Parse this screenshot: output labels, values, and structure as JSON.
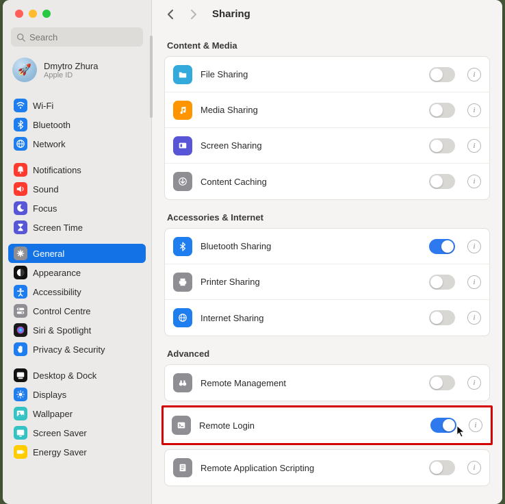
{
  "search": {
    "placeholder": "Search"
  },
  "profile": {
    "name": "Dmytro Zhura",
    "sub": "Apple ID"
  },
  "sidebar": {
    "groups": [
      {
        "items": [
          {
            "label": "Wi-Fi",
            "color": "#1e7def",
            "glyph": "wifi"
          },
          {
            "label": "Bluetooth",
            "color": "#1e7def",
            "glyph": "bt"
          },
          {
            "label": "Network",
            "color": "#1e7def",
            "glyph": "globe"
          }
        ]
      },
      {
        "items": [
          {
            "label": "Notifications",
            "color": "#ff3b30",
            "glyph": "bell"
          },
          {
            "label": "Sound",
            "color": "#ff3b30",
            "glyph": "sound"
          },
          {
            "label": "Focus",
            "color": "#5856d6",
            "glyph": "moon"
          },
          {
            "label": "Screen Time",
            "color": "#5856d6",
            "glyph": "hourglass"
          }
        ]
      },
      {
        "items": [
          {
            "label": "General",
            "color": "#8e8e93",
            "glyph": "gear",
            "selected": true
          },
          {
            "label": "Appearance",
            "color": "#111111",
            "glyph": "appearance"
          },
          {
            "label": "Accessibility",
            "color": "#1e7def",
            "glyph": "access"
          },
          {
            "label": "Control Centre",
            "color": "#8e8e93",
            "glyph": "switches"
          },
          {
            "label": "Siri & Spotlight",
            "color": "#1a1a1a",
            "glyph": "siri"
          },
          {
            "label": "Privacy & Security",
            "color": "#1e7def",
            "glyph": "hand"
          }
        ]
      },
      {
        "items": [
          {
            "label": "Desktop & Dock",
            "color": "#111111",
            "glyph": "dock"
          },
          {
            "label": "Displays",
            "color": "#1e7def",
            "glyph": "sun"
          },
          {
            "label": "Wallpaper",
            "color": "#35c2c2",
            "glyph": "wallpaper"
          },
          {
            "label": "Screen Saver",
            "color": "#35c2c2",
            "glyph": "screensaver"
          },
          {
            "label": "Energy Saver",
            "color": "#ffcc00",
            "glyph": "battery"
          }
        ]
      }
    ]
  },
  "header": {
    "title": "Sharing"
  },
  "sections": [
    {
      "label": "Content & Media",
      "items": [
        {
          "label": "File Sharing",
          "color": "#34aadc",
          "glyph": "folder",
          "on": false
        },
        {
          "label": "Media Sharing",
          "color": "#ff9500",
          "glyph": "music",
          "on": false
        },
        {
          "label": "Screen Sharing",
          "color": "#5856d6",
          "glyph": "screen",
          "on": false
        },
        {
          "label": "Content Caching",
          "color": "#8e8e93",
          "glyph": "download",
          "on": false
        }
      ]
    },
    {
      "label": "Accessories & Internet",
      "items": [
        {
          "label": "Bluetooth Sharing",
          "color": "#1e7def",
          "glyph": "bt",
          "on": true
        },
        {
          "label": "Printer Sharing",
          "color": "#8e8e93",
          "glyph": "printer",
          "on": false
        },
        {
          "label": "Internet Sharing",
          "color": "#1e7def",
          "glyph": "globe",
          "on": false
        }
      ]
    },
    {
      "label": "Advanced",
      "items": [
        {
          "label": "Remote Management",
          "color": "#8e8e93",
          "glyph": "binoculars",
          "on": false
        },
        {
          "label": "Remote Login",
          "color": "#8e8e93",
          "glyph": "terminal",
          "on": true,
          "highlight": true
        },
        {
          "label": "Remote Application Scripting",
          "color": "#8e8e93",
          "glyph": "script",
          "on": false
        }
      ]
    }
  ]
}
